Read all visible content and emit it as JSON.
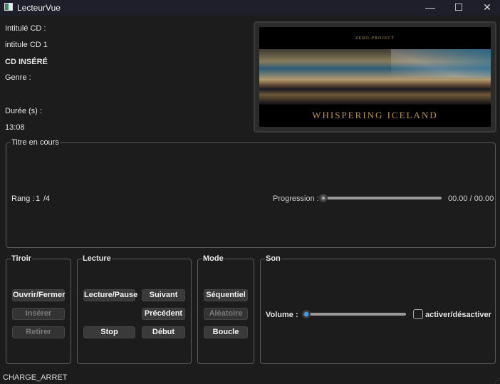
{
  "window": {
    "title": "LecteurVue",
    "minimize": "—",
    "maximize": "☐",
    "close": "✕"
  },
  "info": {
    "intitule_label": "Intitulé CD :",
    "intitule_value": "intitule CD 1",
    "cd_state": "CD INSÉRÉ",
    "genre_label": "Genre :",
    "duree_label": "Durée (s) :",
    "duree_value": "13:08"
  },
  "cover": {
    "artist": "ZERO-PROJECT",
    "album": "WHISPERING ICELAND"
  },
  "titre": {
    "group_title": "Titre en cours",
    "rang_label": "Rang :",
    "rang_value": "1",
    "rang_total": "/4",
    "progress_label": "Progression :",
    "progress_value": 0,
    "time": "00.00 / 00.00"
  },
  "tiroir": {
    "title": "Tiroir",
    "open_close": "Ouvrir/Fermer",
    "insert": "Insérer",
    "remove": "Retirer"
  },
  "lecture": {
    "title": "Lecture",
    "play_pause": "Lecture/Pause",
    "next": "Suivant",
    "prev": "Précédent",
    "stop": "Stop",
    "start": "Début"
  },
  "mode": {
    "title": "Mode",
    "sequential": "Séquentiel",
    "random": "Aléatoire",
    "loop": "Boucle"
  },
  "son": {
    "title": "Son",
    "volume_label": "Volume :",
    "volume_value": 0,
    "mute_label": "activer/désactiver",
    "mute_checked": false
  },
  "status": "CHARGE_ARRET"
}
